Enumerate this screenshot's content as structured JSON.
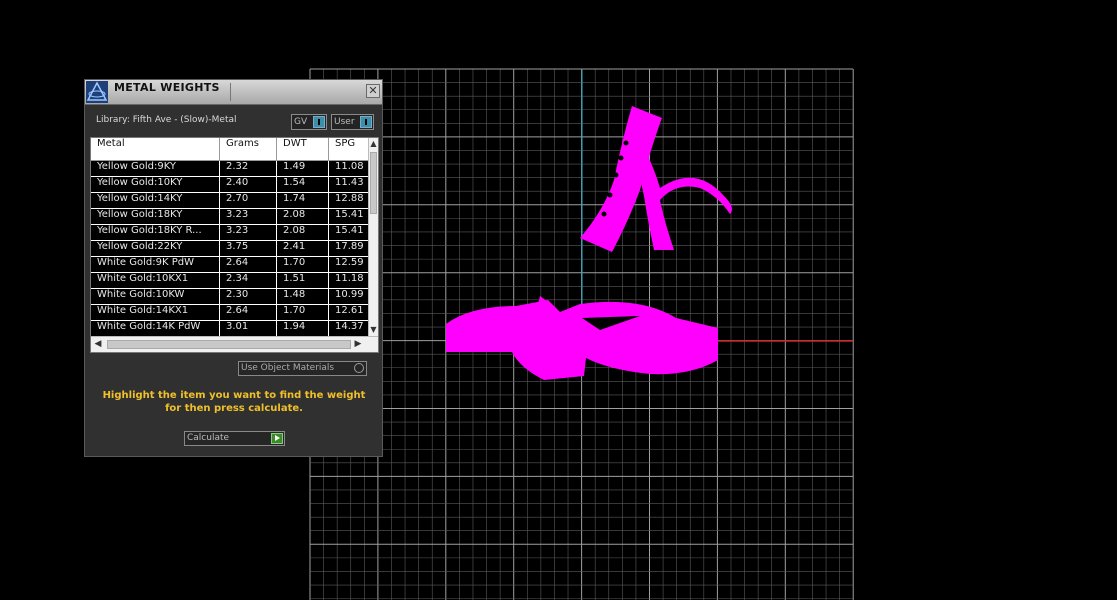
{
  "panel": {
    "title": "METAL WEIGHTS",
    "close_glyph": "✕",
    "library_label": "Library: Fifth Ave - (Slow)-Metal",
    "toggle_gv": "GV",
    "toggle_user": "User",
    "use_object_materials_label": "Use Object Materials",
    "hint_line1": "Highlight the item you want to find the weight",
    "hint_line2": "for then press calculate.",
    "calculate_label": "Calculate",
    "icons": {
      "logo": "matrix-logo-icon",
      "close": "close-icon",
      "scroll_up": "scroll-up-arrow-icon",
      "scroll_down": "scroll-down-arrow-icon",
      "scroll_left": "scroll-left-arrow-icon",
      "scroll_right": "scroll-right-arrow-icon",
      "calculate": "play-arrow-icon"
    }
  },
  "table": {
    "columns": [
      "Metal",
      "Grams",
      "DWT",
      "SPG"
    ],
    "rows": [
      [
        "Yellow Gold:9KY",
        "2.32",
        "1.49",
        "11.08"
      ],
      [
        "Yellow Gold:10KY",
        "2.40",
        "1.54",
        "11.43"
      ],
      [
        "Yellow Gold:14KY",
        "2.70",
        "1.74",
        "12.88"
      ],
      [
        "Yellow Gold:18KY",
        "3.23",
        "2.08",
        "15.41"
      ],
      [
        "Yellow Gold:18KY R...",
        "3.23",
        "2.08",
        "15.41"
      ],
      [
        "Yellow Gold:22KY",
        "3.75",
        "2.41",
        "17.89"
      ],
      [
        "White Gold:9K PdW",
        "2.64",
        "1.70",
        "12.59"
      ],
      [
        "White Gold:10KX1",
        "2.34",
        "1.51",
        "11.18"
      ],
      [
        "White Gold:10KW",
        "2.30",
        "1.48",
        "10.99"
      ],
      [
        "White Gold:14KX1",
        "2.64",
        "1.70",
        "12.61"
      ],
      [
        "White Gold:14K PdW",
        "3.01",
        "1.94",
        "14.37"
      ]
    ]
  },
  "viewport": {
    "grid_color": "#5a5a5a",
    "grid_bold_color": "#a0a0a0",
    "axis_y_color": "#2aa8c8",
    "axis_x_color": "#c82020",
    "object_color": "#ff00ff"
  }
}
